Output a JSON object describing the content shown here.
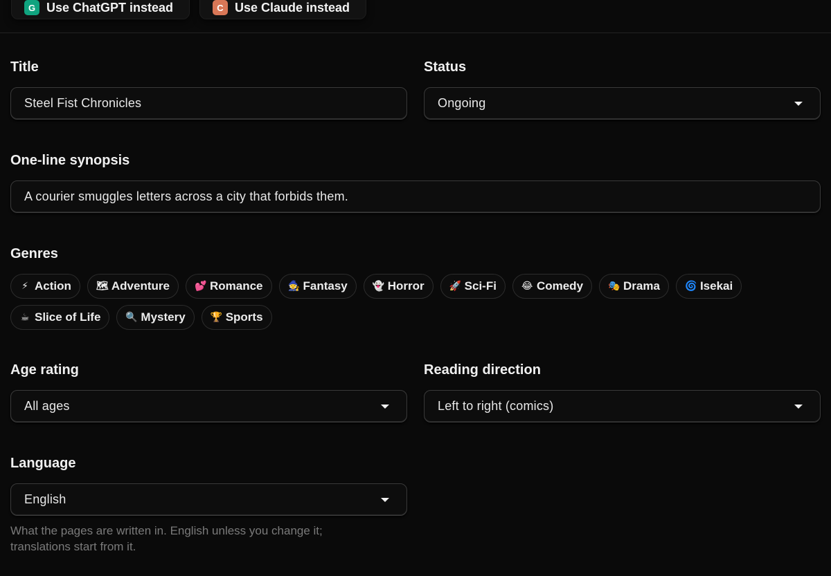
{
  "top_buttons": {
    "chatgpt": {
      "badge": "G",
      "label": "Use ChatGPT instead",
      "color": "#10a37f"
    },
    "claude": {
      "badge": "C",
      "label": "Use Claude instead",
      "color": "#d97757"
    }
  },
  "form": {
    "title": {
      "label": "Title",
      "value": "Steel Fist Chronicles"
    },
    "status": {
      "label": "Status",
      "value": "Ongoing"
    },
    "synopsis": {
      "label": "One-line synopsis",
      "value": "A courier smuggles letters across a city that forbids them."
    },
    "genres": {
      "label": "Genres",
      "items": [
        {
          "icon": "⚡",
          "icon_name": "lightning-icon",
          "label": "Action"
        },
        {
          "icon": "🗺",
          "icon_name": "map-icon",
          "label": "Adventure"
        },
        {
          "icon": "💕",
          "icon_name": "hearts-icon",
          "label": "Romance"
        },
        {
          "icon": "🧙",
          "icon_name": "wizard-icon",
          "label": "Fantasy"
        },
        {
          "icon": "👻",
          "icon_name": "ghost-icon",
          "label": "Horror"
        },
        {
          "icon": "🚀",
          "icon_name": "rocket-icon",
          "label": "Sci-Fi"
        },
        {
          "icon": "😂",
          "icon_name": "laughing-face-icon",
          "label": "Comedy"
        },
        {
          "icon": "🎭",
          "icon_name": "theater-masks-icon",
          "label": "Drama"
        },
        {
          "icon": "🌀",
          "icon_name": "swirl-icon",
          "label": "Isekai"
        },
        {
          "icon": "☕",
          "icon_name": "coffee-icon",
          "label": "Slice of Life"
        },
        {
          "icon": "🔍",
          "icon_name": "magnifier-icon",
          "label": "Mystery"
        },
        {
          "icon": "🏆",
          "icon_name": "trophy-icon",
          "label": "Sports"
        }
      ]
    },
    "age_rating": {
      "label": "Age rating",
      "value": "All ages"
    },
    "reading_direction": {
      "label": "Reading direction",
      "value": "Left to right (comics)"
    },
    "language": {
      "label": "Language",
      "value": "English",
      "help_line1": "What the pages are written in. English unless you change it;",
      "help_line2": "translations start from it."
    }
  }
}
